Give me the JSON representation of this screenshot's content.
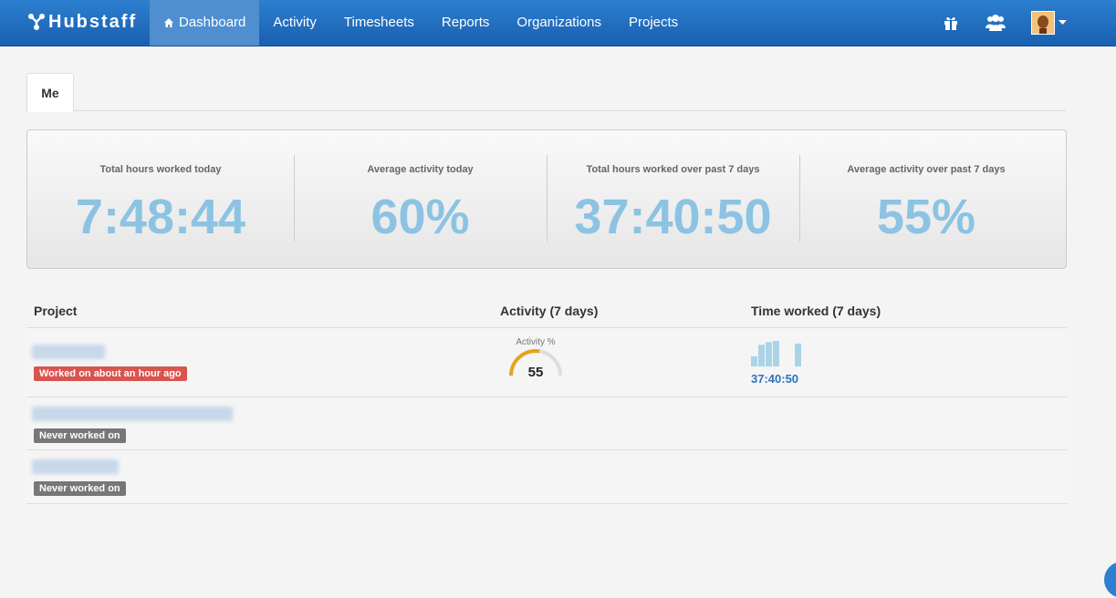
{
  "app": {
    "logo": "Hubstaff",
    "nav": [
      {
        "label": "Dashboard",
        "active": true
      },
      {
        "label": "Activity"
      },
      {
        "label": "Timesheets"
      },
      {
        "label": "Reports"
      },
      {
        "label": "Organizations"
      },
      {
        "label": "Projects"
      }
    ]
  },
  "tabs": [
    "Me"
  ],
  "stats": [
    {
      "label": "Total hours worked today",
      "value": "7:48:44"
    },
    {
      "label": "Average activity today",
      "value": "60%"
    },
    {
      "label": "Total hours worked over past 7 days",
      "value": "37:40:50"
    },
    {
      "label": "Average activity over past 7 days",
      "value": "55%"
    }
  ],
  "table": {
    "headers": [
      "Project",
      "Activity (7 days)",
      "Time worked (7 days)"
    ],
    "rows": [
      {
        "status": "Worked on about an hour ago",
        "status_color": "#d9534f",
        "activity_label": "Activity %",
        "activity_value": "55",
        "activity_percent": 55,
        "time_worked": "37:40:50",
        "daily_hours_relative": [
          0.4,
          0.85,
          0.95,
          1.0,
          0,
          0,
          0.9
        ]
      },
      {
        "status": "Never worked on",
        "status_color": "#777777"
      },
      {
        "status": "Never worked on",
        "status_color": "#777777"
      }
    ]
  },
  "colors": {
    "topbar": "#1a5fb0",
    "nav_active": "#4f8fd0",
    "stat_value": "#8cc3e3",
    "gauge_arc": "#e8a21a",
    "time_value": "#2d73bd"
  },
  "icons": [
    "hubstaff-logo-icon",
    "home-icon",
    "gift-icon",
    "users-icon",
    "avatar",
    "caret-down-icon"
  ]
}
